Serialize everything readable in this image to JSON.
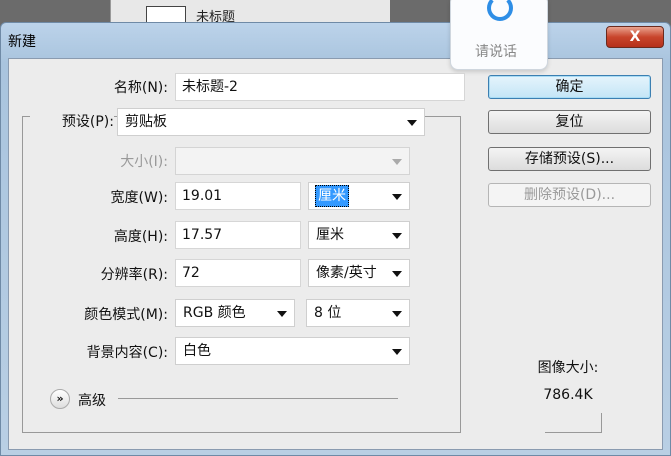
{
  "background": {
    "doc_label": "未标题"
  },
  "voice": {
    "label": "请说话"
  },
  "dialog": {
    "title": "新建",
    "close": "X"
  },
  "form": {
    "name_label": "名称(N):",
    "name_value": "未标题-2",
    "preset_label": "预设(P):",
    "preset_value": "剪贴板",
    "size_label": "大小(I):",
    "width_label": "宽度(W):",
    "width_value": "19.01",
    "width_unit": "厘米",
    "height_label": "高度(H):",
    "height_value": "17.57",
    "height_unit": "厘米",
    "resolution_label": "分辨率(R):",
    "resolution_value": "72",
    "resolution_unit": "像素/英寸",
    "color_mode_label": "颜色模式(M):",
    "color_mode_value": "RGB 颜色",
    "bit_depth": "8 位",
    "background_label": "背景内容(C):",
    "background_value": "白色",
    "advanced_label": "高级"
  },
  "buttons": {
    "ok": "确定",
    "reset": "复位",
    "save_preset": "存储预设(S)...",
    "delete_preset": "删除预设(D)..."
  },
  "image_size": {
    "label": "图像大小:",
    "value": "786.4K"
  }
}
